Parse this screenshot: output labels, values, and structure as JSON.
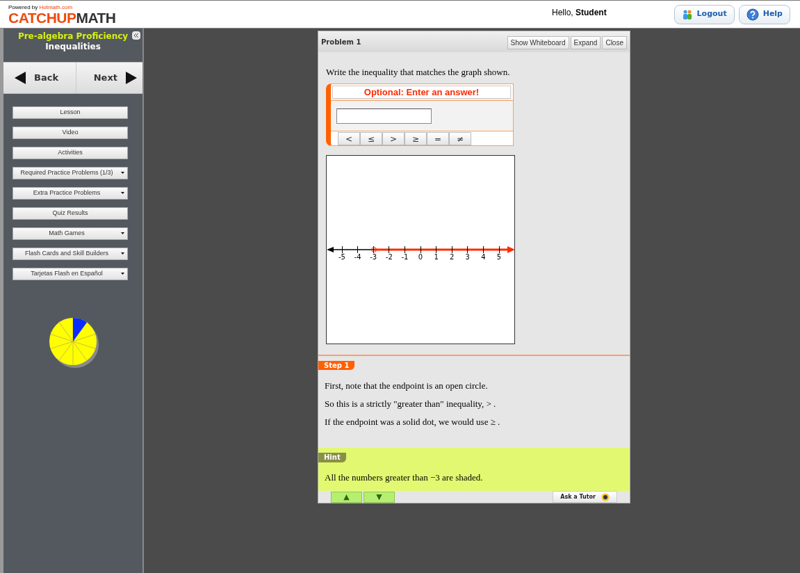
{
  "header": {
    "powered_by": "Powered by",
    "powered_by_site": "Hotmath.com",
    "logo_part1": "CATCHUP",
    "logo_part2": "MATH",
    "greeting": "Hello,",
    "user": "Student",
    "buttons": [
      {
        "kind": "logout",
        "label": "Logout"
      },
      {
        "kind": "help",
        "label": "Help"
      }
    ]
  },
  "sidebar": {
    "course": "Pre-algebra Proficiency",
    "topic": "Inequalities",
    "back": "Back",
    "next": "Next",
    "items": [
      {
        "label": "Lesson",
        "dropdown": false
      },
      {
        "label": "Video",
        "dropdown": false
      },
      {
        "label": "Activities",
        "dropdown": false
      },
      {
        "label": "Required Practice Problems (1/3)",
        "dropdown": true
      },
      {
        "label": "Extra Practice Problems",
        "dropdown": true
      },
      {
        "label": "Quiz Results",
        "dropdown": false
      },
      {
        "label": "Math Games",
        "dropdown": true
      },
      {
        "label": "Flash Cards and Skill Builders",
        "dropdown": true
      },
      {
        "label": "Tarjetas Flash en Español",
        "dropdown": true
      }
    ],
    "progress_pie": true
  },
  "problem": {
    "title": "Problem 1",
    "buttons": [
      "Show Whiteboard",
      "Expand",
      "Close"
    ],
    "question": "Write the inequality that matches the graph shown.",
    "answer": {
      "banner": "Optional: Enter an answer!",
      "symbols": [
        "<",
        "≤",
        ">",
        "≥",
        "=",
        "≠"
      ]
    },
    "number_line": {
      "open": true,
      "ticks": [
        {
          "label": "-5",
          "endpoint": false
        },
        {
          "label": "-4",
          "endpoint": false
        },
        {
          "label": "-3",
          "endpoint": true
        },
        {
          "label": "-2",
          "endpoint": false
        },
        {
          "label": "-1",
          "endpoint": false
        },
        {
          "label": "0",
          "endpoint": false
        },
        {
          "label": "1",
          "endpoint": false
        },
        {
          "label": "2",
          "endpoint": false
        },
        {
          "label": "3",
          "endpoint": false
        },
        {
          "label": "4",
          "endpoint": false
        },
        {
          "label": "5",
          "endpoint": false
        }
      ]
    },
    "step": {
      "tag": "Step 1",
      "lines": [
        "First, note that the endpoint is an open circle.",
        "So this is a strictly \"greater than\" inequality, >  .",
        "If the endpoint was a solid dot, we would use ≥  ."
      ]
    },
    "hint": {
      "tag": "Hint",
      "text": "All the numbers greater than −3 are shaded."
    },
    "footer": {
      "up": "▲",
      "down": "▼",
      "ask": "Ask a Tutor"
    }
  }
}
